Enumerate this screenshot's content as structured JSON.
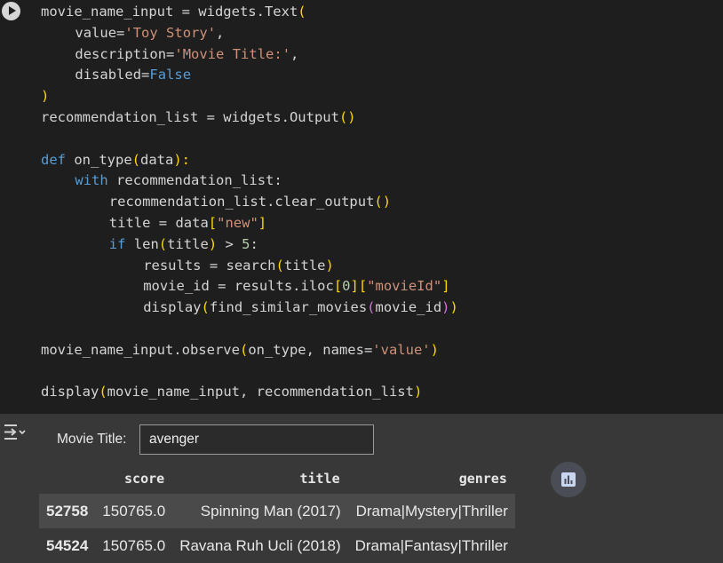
{
  "code": {
    "line01": [
      "movie_name_input = widgets.Text",
      "("
    ],
    "line02": [
      "value=",
      "'Toy Story'",
      ","
    ],
    "line03": [
      "description=",
      "'Movie Title:'",
      ","
    ],
    "line04": [
      "disabled=",
      "False"
    ],
    "line05": [
      ")"
    ],
    "line06": [
      "recommendation_list = widgets.Output",
      "()"
    ],
    "line08": [
      "def",
      " on_type",
      "(",
      "data",
      "):"
    ],
    "line09": [
      "with",
      " recommendation_list:"
    ],
    "line10": [
      "recommendation_list.clear_output",
      "()"
    ],
    "line11": [
      "title = data",
      "[",
      "\"new\"",
      "]"
    ],
    "line12": [
      "if",
      " len",
      "(",
      "title",
      ")",
      " > ",
      "5",
      ":"
    ],
    "line13": [
      "results = search",
      "(",
      "title",
      ")"
    ],
    "line14": [
      "movie_id = results.iloc",
      "[",
      "0",
      "][",
      "\"movieId\"",
      "]"
    ],
    "line15": [
      "display",
      "(",
      "find_similar_movies",
      "(",
      "movie_id",
      ")",
      ")"
    ],
    "line17": [
      "movie_name_input.observe",
      "(",
      "on_type, names=",
      "'value'",
      ")"
    ],
    "line19": [
      "display",
      "(",
      "movie_name_input, recommendation_list",
      ")"
    ]
  },
  "widget": {
    "label": "Movie Title:",
    "value": "avenger"
  },
  "table": {
    "columns": [
      "score",
      "title",
      "genres"
    ],
    "rows": [
      {
        "index": "52758",
        "score": "150765.0",
        "title": "Spinning Man (2017)",
        "genres": "Drama|Mystery|Thriller"
      },
      {
        "index": "54524",
        "score": "150765.0",
        "title": "Ravana Ruh Ucli (2018)",
        "genres": "Drama|Fantasy|Thriller"
      }
    ]
  },
  "icons": {
    "run": "play-circle-icon",
    "output_toggle": "output-collapse-icon",
    "chart": "bar-chart-icon"
  }
}
